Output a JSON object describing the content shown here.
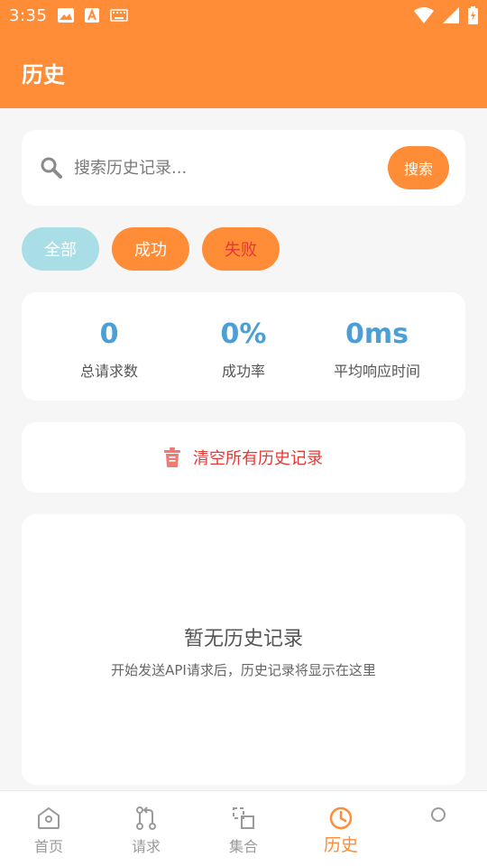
{
  "status_bar": {
    "time": "3:35"
  },
  "app_bar": {
    "title": "历史"
  },
  "search": {
    "placeholder": "搜索历史记录...",
    "button_label": "搜索"
  },
  "filters": [
    {
      "label": "全部"
    },
    {
      "label": "成功"
    },
    {
      "label": "失败"
    }
  ],
  "stats": [
    {
      "value": "0",
      "label": "总请求数"
    },
    {
      "value": "0%",
      "label": "成功率"
    },
    {
      "value": "0ms",
      "label": "平均响应时间"
    }
  ],
  "clear": {
    "label": "清空所有历史记录"
  },
  "empty_state": {
    "title": "暂无历史记录",
    "subtitle": "开始发送API请求后，历史记录将显示在这里"
  },
  "bottom_nav": [
    {
      "label": "首页",
      "icon": "home-icon"
    },
    {
      "label": "请求",
      "icon": "request-icon"
    },
    {
      "label": "集合",
      "icon": "collection-icon"
    },
    {
      "label": "历史",
      "icon": "clock-icon",
      "active": true
    },
    {
      "label": "",
      "icon": "circle-icon"
    }
  ],
  "colors": {
    "primary": "#ff8c37",
    "chip_all": "#a9dee6",
    "stat_value": "#4a9fd6",
    "danger": "#e53935"
  }
}
